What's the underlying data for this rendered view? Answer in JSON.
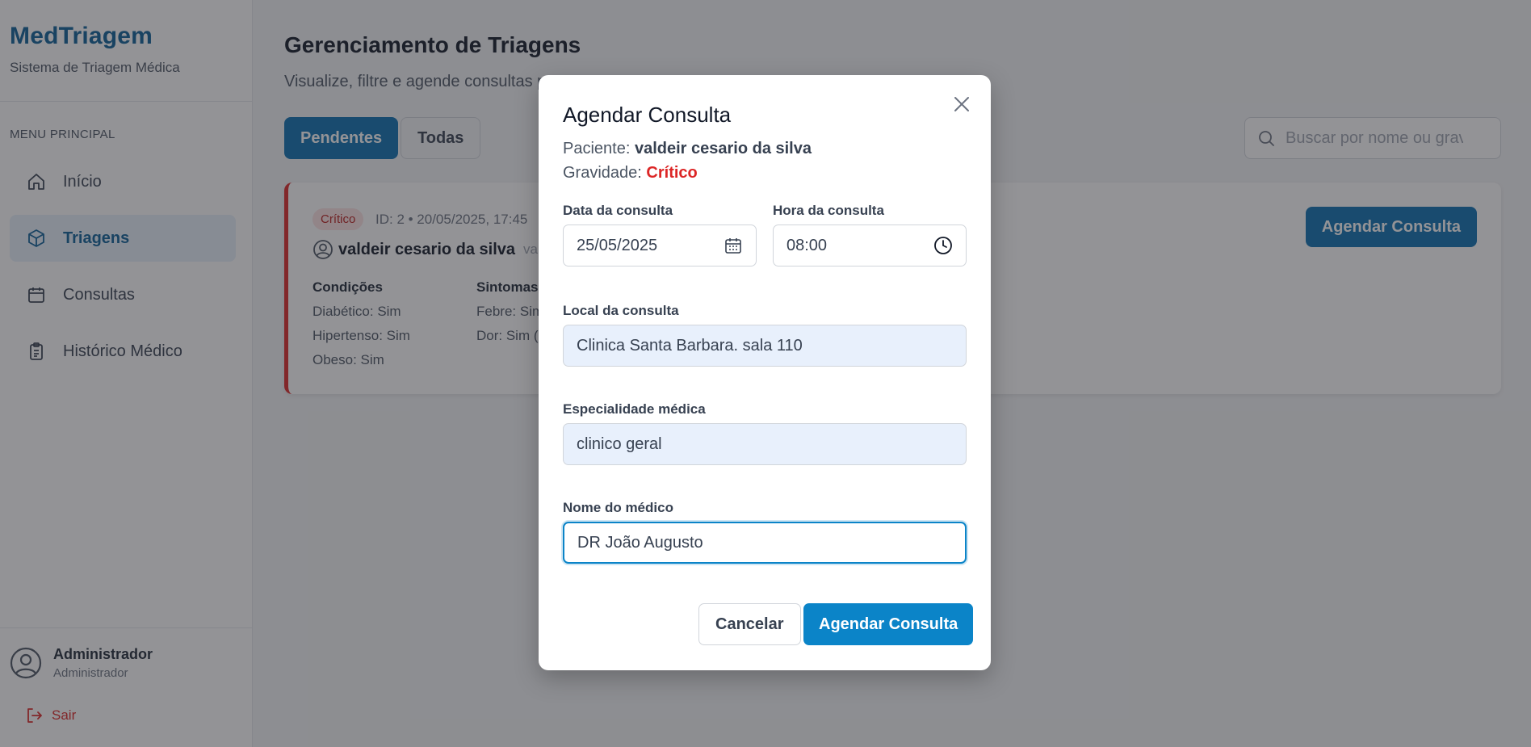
{
  "sidebar": {
    "brand_title": "MedTriagem",
    "brand_subtitle": "Sistema de Triagem Médica",
    "menu_heading": "MENU PRINCIPAL",
    "items": [
      {
        "label": "Início",
        "icon": "home-icon"
      },
      {
        "label": "Triagens",
        "icon": "cube-icon",
        "active": true
      },
      {
        "label": "Consultas",
        "icon": "calendar-icon"
      },
      {
        "label": "Histórico Médico",
        "icon": "clipboard-icon"
      }
    ],
    "user_name": "Administrador",
    "user_role": "Administrador",
    "logout_label": "Sair"
  },
  "main": {
    "title": "Gerenciamento de Triagens",
    "subtitle": "Visualize, filtre e agende consultas p",
    "tabs": [
      {
        "label": "Pendentes",
        "active": true
      },
      {
        "label": "Todas",
        "active": false
      }
    ],
    "search_placeholder": "Buscar por nome ou gravidade"
  },
  "card": {
    "badge": "Crítico",
    "meta": "ID: 2 • 20/05/2025, 17:45",
    "patient_name": "valdeir cesario da silva",
    "patient_extra": "valde",
    "conditions_head": "Condições",
    "conditions": [
      "Diabético: Sim",
      "Hipertenso: Sim",
      "Obeso: Sim"
    ],
    "symptoms_head": "Sintomas",
    "symptoms": [
      "Febre: Sim",
      "Dor: Sim ("
    ],
    "action_label": "Agendar Consulta"
  },
  "modal": {
    "title": "Agendar Consulta",
    "patient_label": "Paciente:",
    "patient_value": "valdeir cesario da silva",
    "severity_label": "Gravidade:",
    "severity_value": "Crítico",
    "date_label": "Data da consulta",
    "date_value": "25/05/2025",
    "time_label": "Hora da consulta",
    "time_value": "08:00",
    "location_label": "Local da consulta",
    "location_value": "Clinica Santa Barbara. sala 110",
    "specialty_label": "Especialidade médica",
    "specialty_value": "clinico geral",
    "doctor_label": "Nome do médico",
    "doctor_value": "DR João Augusto",
    "cancel_label": "Cancelar",
    "submit_label": "Agendar Consulta"
  },
  "colors": {
    "brand": "#0b5f97",
    "primary": "#0b84c8",
    "danger": "#dc2626",
    "overlay": "rgba(40,40,45,0.5)"
  }
}
